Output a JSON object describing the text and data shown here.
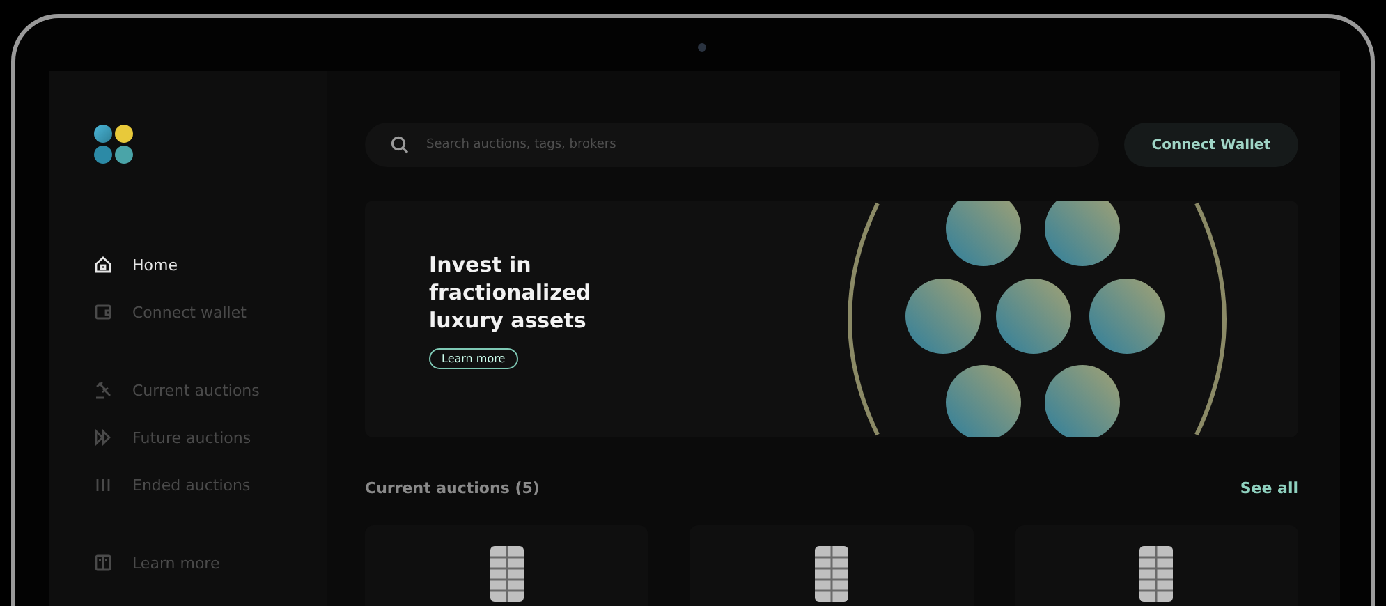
{
  "sidebar": {
    "groups": [
      {
        "items": [
          {
            "label": "Home",
            "kind": "home",
            "selected": true
          },
          {
            "label": "Connect wallet",
            "kind": "wallet",
            "selected": false
          }
        ]
      },
      {
        "items": [
          {
            "label": "Current auctions",
            "kind": "gavel",
            "selected": false
          },
          {
            "label": "Future auctions",
            "kind": "forward",
            "selected": false
          },
          {
            "label": "Ended auctions",
            "kind": "bars",
            "selected": false
          }
        ]
      },
      {
        "items": [
          {
            "label": "Learn more",
            "kind": "book",
            "selected": false
          }
        ]
      }
    ]
  },
  "search": {
    "placeholder": "Search auctions, tags, brokers"
  },
  "connect_button": "Connect Wallet",
  "hero": {
    "headline": "Invest in fractionalized luxury assets",
    "button": "Learn more"
  },
  "section": {
    "title": "Current auctions (5)",
    "link": "See all",
    "cards": [
      {
        "kind": "watch"
      },
      {
        "kind": "watch"
      },
      {
        "kind": "watch"
      }
    ]
  }
}
